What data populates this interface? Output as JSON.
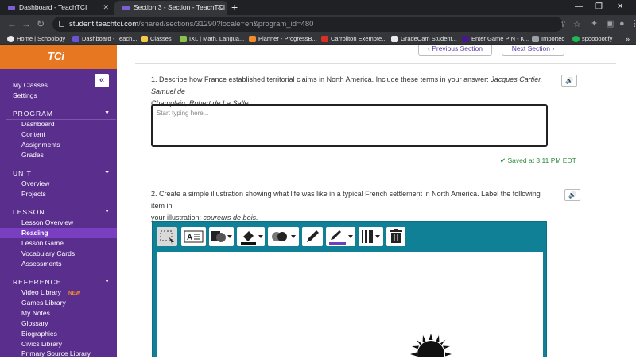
{
  "browser": {
    "tabs": [
      {
        "title": "Dashboard - TeachTCI",
        "active": false
      },
      {
        "title": "Section 3 - Section - TeachTCI",
        "active": true
      }
    ],
    "new_tab": "+",
    "url_host": "student.teachtci.com",
    "url_path": "/shared/sections/31290?locale=en&program_id=480",
    "bookmarks": [
      {
        "label": "Home | Schoology",
        "color": "#e8eaed"
      },
      {
        "label": "Dashboard - Teach...",
        "color": "#6b54d3"
      },
      {
        "label": "Classes",
        "color": "#f2c94c"
      },
      {
        "label": "IXL | Math, Langua...",
        "color": "#8bc34a"
      },
      {
        "label": "Planner - ProgressB...",
        "color": "#f08c2c"
      },
      {
        "label": "Carrollton Exempte...",
        "color": "#d93025"
      },
      {
        "label": "GradeCam Student...",
        "color": "#e8eaed"
      },
      {
        "label": "Enter Game PIN - K...",
        "color": "#46178f"
      },
      {
        "label": "Imported",
        "color": "#9aa0a6"
      },
      {
        "label": "spoooootify",
        "color": "#1db954"
      }
    ]
  },
  "sidebar": {
    "logo": "TCi",
    "top_links": [
      "My Classes",
      "Settings"
    ],
    "sections": [
      {
        "title": "PROGRAM",
        "items": [
          "Dashboard",
          "Content",
          "Assignments",
          "Grades"
        ]
      },
      {
        "title": "UNIT",
        "items": [
          "Overview",
          "Projects"
        ]
      },
      {
        "title": "LESSON",
        "items": [
          "Lesson Overview",
          "Reading",
          "Lesson Game",
          "Vocabulary Cards",
          "Assessments"
        ],
        "active": "Reading"
      },
      {
        "title": "REFERENCE",
        "items": [
          "Video Library",
          "Games Library",
          "My Notes",
          "Glossary",
          "Biographies",
          "Civics Library",
          "Primary Source Library"
        ]
      }
    ],
    "new_badge": "NEW"
  },
  "main": {
    "previous_section": "Previous Section",
    "next_section": "Next Section",
    "q1": {
      "text_plain": "1. Describe how France established territorial claims in North America. Include these terms in your answer: ",
      "terms_line1": "Jacques Cartier, Samuel de",
      "terms_line2": "Champlain, Robert de La Salle."
    },
    "answer_placeholder": "Start typing here...",
    "saved_status": "Saved at 3:11 PM EDT",
    "q2": {
      "line1": "2. Create a simple illustration showing what life was like in a typical French settlement in North America. Label the following item in",
      "line2_plain": "your illustration: ",
      "line2_term": "coureurs de bois."
    }
  },
  "colors": {
    "sidebar": "#5a2e8c",
    "logo_bar": "#e87722",
    "active_item": "#7a3fc0",
    "drawing_frame": "#0f8096",
    "saved": "#2c8a3d"
  },
  "icons": [
    "back-arrow",
    "forward-arrow",
    "reload",
    "lock",
    "share",
    "star",
    "extensions",
    "sidebar",
    "profile",
    "menu",
    "speaker",
    "checkmark",
    "select-tool",
    "text-tool",
    "shape-tool",
    "fill-tool",
    "opacity-tool",
    "pencil-tool",
    "line-color-tool",
    "line-width-tool",
    "trash-tool",
    "sun-drawing"
  ]
}
